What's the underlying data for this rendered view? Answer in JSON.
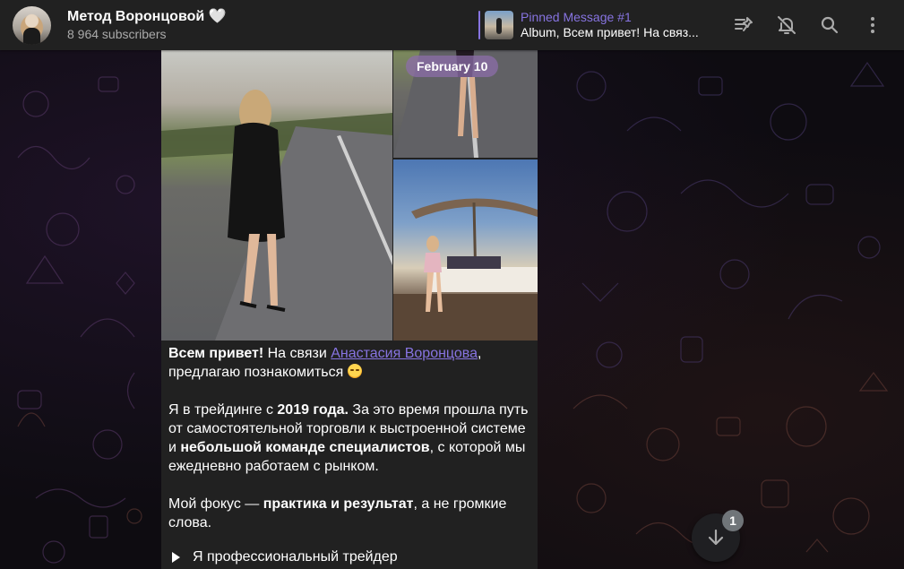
{
  "header": {
    "channel_title": "Метод Воронцовой 🤍",
    "subscribers": "8 964 subscribers",
    "pinned": {
      "title": "Pinned Message #1",
      "text": "Album, Всем привет! На связ..."
    },
    "icons": [
      "pinned-list-icon",
      "mute-icon",
      "search-icon",
      "more-icon"
    ]
  },
  "message": {
    "date": "February 10",
    "greeting_bold": "Всем привет!",
    "intro_text": " На связи ",
    "author_link": "Анастасия Воронцова",
    "intro_after": ",",
    "intro_line2": "предлагаю познакомиться ",
    "p2_a": "Я в трейдинге с ",
    "p2_b": "2019 года.",
    "p2_c": " За это время прошла путь от самостоятельной торговли к выстроенной системе и ",
    "p2_d": "небольшой команде специалистов",
    "p2_e": ", с которой мы ежедневно работаем с рынком.",
    "p3_a": "Мой фокус — ",
    "p3_b": "практика и результат",
    "p3_c": ", а не громкие слова.",
    "bullet_1": "Я профессиональный трейдер"
  },
  "scroll_down": {
    "unread_count": "1"
  },
  "colors": {
    "accent": "#8774e1",
    "header_bg": "#212121",
    "bubble_bg": "#212121"
  }
}
